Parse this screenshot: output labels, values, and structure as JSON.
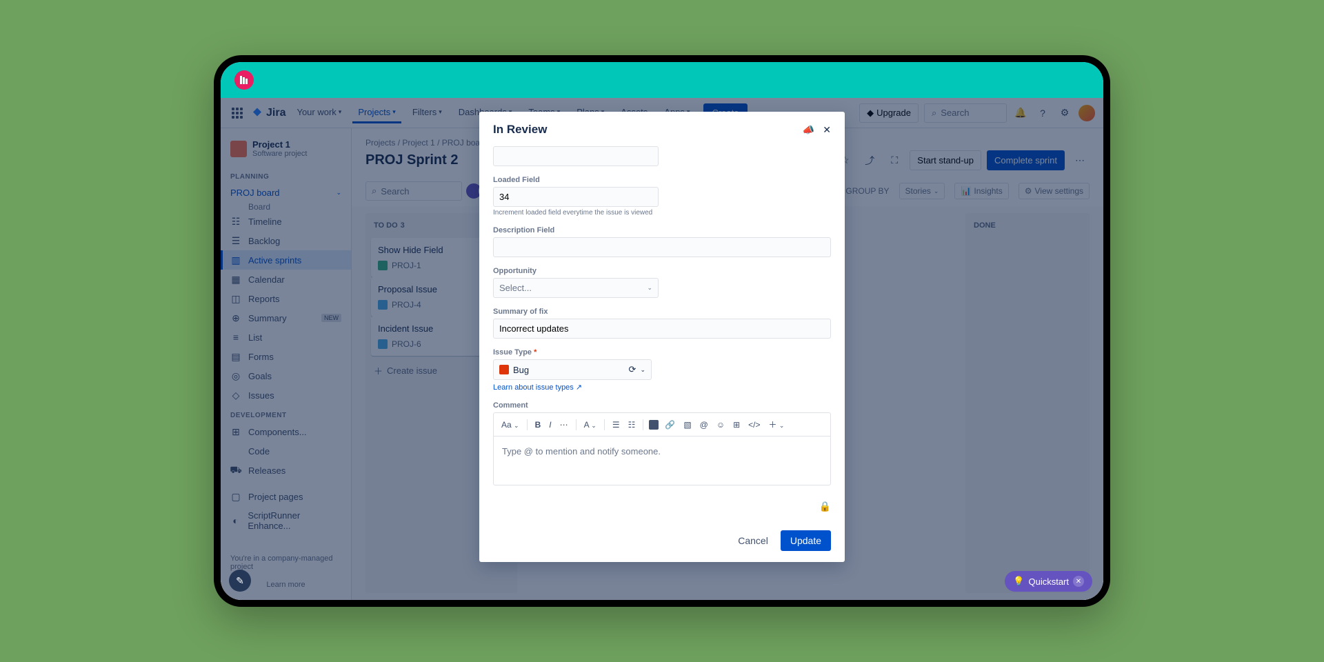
{
  "brand": {
    "name": "Jira"
  },
  "nav": [
    {
      "label": "Your work",
      "dd": true
    },
    {
      "label": "Projects",
      "dd": true,
      "active": true
    },
    {
      "label": "Filters",
      "dd": true
    },
    {
      "label": "Dashboards",
      "dd": true
    },
    {
      "label": "Teams",
      "dd": true
    },
    {
      "label": "Plans",
      "dd": true
    },
    {
      "label": "Assets"
    },
    {
      "label": "Apps",
      "dd": true
    }
  ],
  "create_label": "Create",
  "upgrade_label": "Upgrade",
  "search_placeholder": "Search",
  "project": {
    "name": "Project 1",
    "type": "Software project"
  },
  "sidebar": {
    "planning_label": "PLANNING",
    "dev_label": "DEVELOPMENT",
    "board_item": "PROJ board",
    "board_sub": "Board",
    "items_planning": [
      {
        "icon": "☷",
        "label": "Timeline"
      },
      {
        "icon": "☰",
        "label": "Backlog"
      },
      {
        "icon": "▥",
        "label": "Active sprints",
        "sel": true
      },
      {
        "icon": "▦",
        "label": "Calendar"
      },
      {
        "icon": "◫",
        "label": "Reports"
      },
      {
        "icon": "⊕",
        "label": "Summary",
        "badge": "NEW"
      },
      {
        "icon": "≡",
        "label": "List"
      },
      {
        "icon": "▤",
        "label": "Forms"
      },
      {
        "icon": "◎",
        "label": "Goals"
      },
      {
        "icon": "◇",
        "label": "Issues"
      }
    ],
    "items_dev": [
      {
        "icon": "⊞",
        "label": "Components..."
      },
      {
        "icon": "</>",
        "label": "Code"
      },
      {
        "icon": "⛟",
        "label": "Releases"
      }
    ],
    "items_other": [
      {
        "icon": "▢",
        "label": "Project pages"
      },
      {
        "icon": "◐",
        "label": "ScriptRunner Enhance..."
      }
    ],
    "footer": "You're in a company-managed project",
    "learn_more": "Learn more"
  },
  "breadcrumb": {
    "a": "Projects",
    "b": "Project 1",
    "c": "PROJ board"
  },
  "board": {
    "title": "PROJ Sprint 2",
    "actions": {
      "standup": "Start stand-up",
      "complete": "Complete sprint"
    },
    "search_placeholder": "Search",
    "groupby_label": "GROUP BY",
    "groupby_value": "Stories",
    "insights": "Insights",
    "view_settings": "View settings",
    "col_todo": "TO DO",
    "col_todo_count": "3",
    "col_done": "DONE",
    "cards": [
      {
        "title": "Show Hide Field",
        "key": "PROJ-1",
        "type": "story"
      },
      {
        "title": "Proposal Issue",
        "key": "PROJ-4",
        "type": "task"
      },
      {
        "title": "Incident Issue",
        "key": "PROJ-6",
        "type": "task"
      }
    ],
    "create_issue": "Create issue"
  },
  "modal": {
    "title": "In Review",
    "fields": {
      "loaded_label": "Loaded Field",
      "loaded_value": "34",
      "loaded_help": "Increment loaded field everytime the issue is viewed",
      "desc_label": "Description Field",
      "opportunity_label": "Opportunity",
      "opportunity_placeholder": "Select...",
      "summary_label": "Summary of fix",
      "summary_value": "Incorrect updates",
      "issuetype_label": "Issue Type",
      "issuetype_value": "Bug",
      "learn_link": "Learn about issue types",
      "comment_label": "Comment",
      "comment_placeholder": "Type @ to mention and notify someone."
    },
    "editor_heading": "Aa",
    "cancel": "Cancel",
    "update": "Update"
  },
  "quickstart": "Quickstart"
}
